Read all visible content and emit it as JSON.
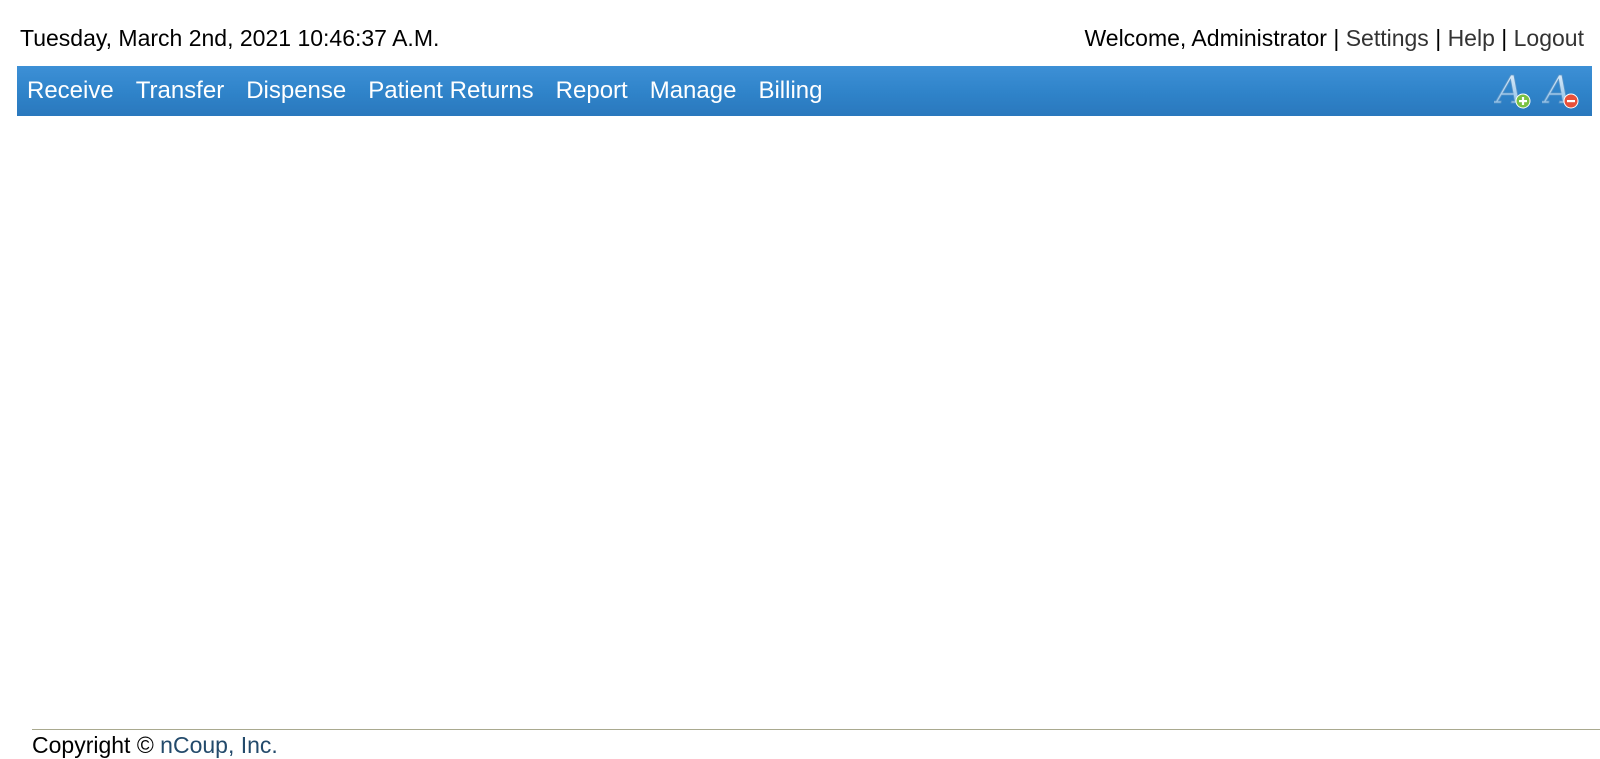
{
  "header": {
    "datetime": "Tuesday, March 2nd, 2021 10:46:37 A.M.",
    "welcome": "Welcome, Administrator",
    "separator": "|",
    "links": {
      "settings": "Settings",
      "help": "Help",
      "logout": "Logout"
    }
  },
  "nav": {
    "items": [
      {
        "label": "Receive"
      },
      {
        "label": "Transfer"
      },
      {
        "label": "Dispense"
      },
      {
        "label": "Patient Returns"
      },
      {
        "label": "Report"
      },
      {
        "label": "Manage"
      },
      {
        "label": "Billing"
      }
    ],
    "tools": {
      "increase_icon": "font-increase-icon",
      "decrease_icon": "font-decrease-icon"
    },
    "colors": {
      "bar": "#2f83c9",
      "text": "#ffffff",
      "plus_badge": "#7ac143",
      "minus_badge": "#e8503a"
    }
  },
  "footer": {
    "copyright": "Copyright ©",
    "company": "nCoup, Inc."
  }
}
